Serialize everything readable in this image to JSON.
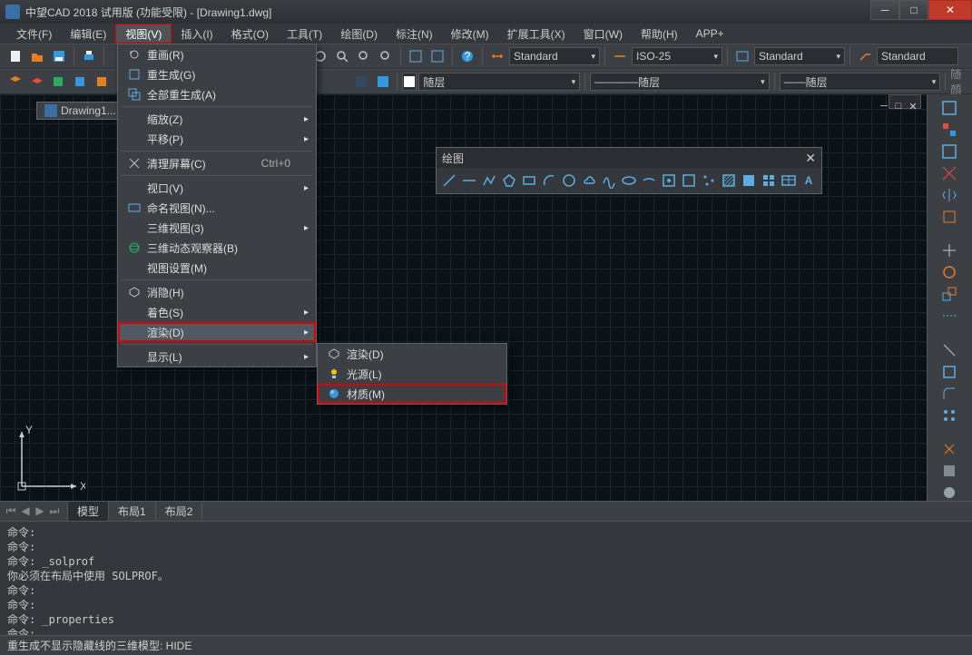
{
  "title": "中望CAD 2018 试用版 (功能受限) - [Drawing1.dwg]",
  "menubar": [
    "文件(F)",
    "编辑(E)",
    "视图(V)",
    "插入(I)",
    "格式(O)",
    "工具(T)",
    "绘图(D)",
    "标注(N)",
    "修改(M)",
    "扩展工具(X)",
    "窗口(W)",
    "帮助(H)",
    "APP+"
  ],
  "active_menu_index": 2,
  "toolbar2": {
    "layer": "随层",
    "style1": "Standard",
    "style2": "ISO-25",
    "style3": "Standard",
    "style4": "Standard",
    "linetype1": "随层",
    "linetype2": "随层",
    "linetype3": "随顔"
  },
  "doc_tab": "Drawing1...",
  "view_menu": {
    "items": [
      {
        "label": "重画(R)",
        "icon": "refresh"
      },
      {
        "label": "重生成(G)",
        "icon": "regen"
      },
      {
        "label": "全部重生成(A)",
        "icon": "regenall"
      },
      {
        "sep": true
      },
      {
        "label": "缩放(Z)",
        "sub": true
      },
      {
        "label": "平移(P)",
        "sub": true
      },
      {
        "sep": true
      },
      {
        "label": "清理屏幕(C)",
        "icon": "clean",
        "shortcut": "Ctrl+0"
      },
      {
        "sep": true
      },
      {
        "label": "视口(V)",
        "sub": true
      },
      {
        "label": "命名视图(N)...",
        "icon": "named"
      },
      {
        "label": "三维视图(3)",
        "sub": true
      },
      {
        "label": "三维动态观察器(B)",
        "icon": "orbit"
      },
      {
        "label": "视图设置(M)"
      },
      {
        "sep": true
      },
      {
        "label": "消隐(H)",
        "icon": "hide"
      },
      {
        "label": "着色(S)",
        "sub": true
      },
      {
        "label": "渲染(D)",
        "sub": true,
        "hov": true,
        "hl": true
      },
      {
        "sep": true
      },
      {
        "label": "显示(L)",
        "sub": true
      }
    ]
  },
  "render_submenu": {
    "items": [
      {
        "label": "渲染(D)",
        "icon": "render"
      },
      {
        "label": "光源(L)",
        "icon": "light"
      },
      {
        "label": "材质(M)",
        "icon": "material",
        "hl": true
      }
    ]
  },
  "drawbar_title": "绘图",
  "bottom_tabs": [
    "模型",
    "布局1",
    "布局2"
  ],
  "active_btab": 0,
  "cmd_lines": [
    "命令:",
    "命令:",
    "命令: _solprof",
    "你必须在布局中使用 SOLPROF。",
    "命令:",
    "命令:",
    "命令: _properties",
    "命令:"
  ],
  "status": "重生成不显示隐藏线的三维模型: HIDE",
  "axis": {
    "x": "X",
    "y": "Y"
  }
}
